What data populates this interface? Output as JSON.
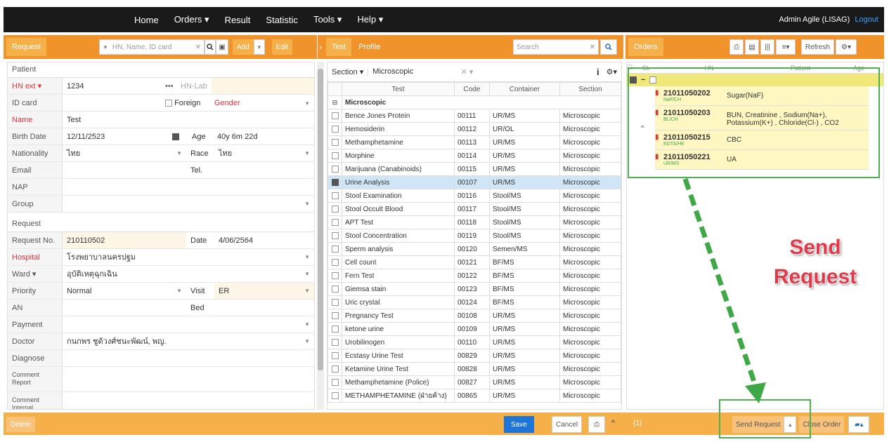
{
  "nav": {
    "items": [
      "Home",
      "Orders ▾",
      "Result",
      "Statistic",
      "Tools ▾",
      "Help ▾"
    ],
    "user": "Admin Agile (LISAG)",
    "logout": "Logout"
  },
  "request_bar": {
    "tab": "Request",
    "search_placeholder": "HN, Name, ID card",
    "add": "Add",
    "edit": "Edit"
  },
  "test_bar": {
    "tab_test": "Test",
    "tab_profile": "Profile",
    "search_placeholder": "Search"
  },
  "orders_bar": {
    "tab": "Orders",
    "refresh": "Refresh"
  },
  "patient": {
    "section": "Patient",
    "hn_label": "HN ext",
    "hn_value": "1234",
    "hnlab_label": "HN-Lab",
    "idcard_label": "ID card",
    "foreign_label": "Foreign",
    "gender_label": "Gender",
    "name_label": "Name",
    "name_value": "Test",
    "birth_label": "Birth Date",
    "birth_value": "12/11/2523",
    "age_label": "Age",
    "age_value": "40y 6m 22d",
    "nat_label": "Nationality",
    "nat_value": "ไทย",
    "race_label": "Race",
    "race_value": "ไทย",
    "email_label": "Email",
    "tel_label": "Tel.",
    "nap_label": "NAP",
    "group_label": "Group"
  },
  "request": {
    "section": "Request",
    "reqno_label": "Request No.",
    "reqno_value": "210110502",
    "date_label": "Date",
    "date_value": "4/06/2564",
    "hospital_label": "Hospital",
    "hospital_value": "โรงพยาบาลนครปฐม",
    "ward_label": "Ward",
    "ward_value": "อุบัติเหตุฉุกเฉิน",
    "priority_label": "Priority",
    "priority_value": "Normal",
    "visit_label": "Visit",
    "visit_value": "ER",
    "an_label": "AN",
    "bed_label": "Bed",
    "payment_label": "Payment",
    "doctor_label": "Doctor",
    "doctor_value": "กนกพร ชูด้วงศ์ชนะพัฒน์, พญ.",
    "diagnose_label": "Diagnose",
    "comment_report": "Comment Report",
    "comment_internal": "Comment Internal"
  },
  "tests": {
    "section_label": "Section ▾",
    "section_value": "Microscopic",
    "headers": [
      "Test",
      "Code",
      "Container",
      "Section"
    ],
    "group": "Microscopic",
    "rows": [
      {
        "name": "Bence Jones Protein",
        "code": "00111",
        "container": "UR/MS",
        "section": "Microscopic",
        "checked": false
      },
      {
        "name": "Hemosiderin",
        "code": "00112",
        "container": "UR/OL",
        "section": "Microscopic",
        "checked": false
      },
      {
        "name": "Methamphetamine",
        "code": "00113",
        "container": "UR/MS",
        "section": "Microscopic",
        "checked": false
      },
      {
        "name": "Morphine",
        "code": "00114",
        "container": "UR/MS",
        "section": "Microscopic",
        "checked": false
      },
      {
        "name": "Marijuana (Canabinoids)",
        "code": "00115",
        "container": "UR/MS",
        "section": "Microscopic",
        "checked": false
      },
      {
        "name": "Urine Analysis",
        "code": "00107",
        "container": "UR/MS",
        "section": "Microscopic",
        "checked": true
      },
      {
        "name": "Stool Examination",
        "code": "00116",
        "container": "Stool/MS",
        "section": "Microscopic",
        "checked": false
      },
      {
        "name": "Stool Occult Blood",
        "code": "00117",
        "container": "Stool/MS",
        "section": "Microscopic",
        "checked": false
      },
      {
        "name": "APT Test",
        "code": "00118",
        "container": "Stool/MS",
        "section": "Microscopic",
        "checked": false
      },
      {
        "name": "Stool Concentration",
        "code": "00119",
        "container": "Stool/MS",
        "section": "Microscopic",
        "checked": false
      },
      {
        "name": "Sperm analysis",
        "code": "00120",
        "container": "Semen/MS",
        "section": "Microscopic",
        "checked": false
      },
      {
        "name": "Cell count",
        "code": "00121",
        "container": "BF/MS",
        "section": "Microscopic",
        "checked": false
      },
      {
        "name": "Fern Test",
        "code": "00122",
        "container": "BF/MS",
        "section": "Microscopic",
        "checked": false
      },
      {
        "name": "Giemsa stain",
        "code": "00123",
        "container": "BF/MS",
        "section": "Microscopic",
        "checked": false
      },
      {
        "name": "Uric crystal",
        "code": "00124",
        "container": "BF/MS",
        "section": "Microscopic",
        "checked": false
      },
      {
        "name": "Pregnancy Test",
        "code": "00108",
        "container": "UR/MS",
        "section": "Microscopic",
        "checked": false
      },
      {
        "name": "ketone urine",
        "code": "00109",
        "container": "UR/MS",
        "section": "Microscopic",
        "checked": false
      },
      {
        "name": "Urobilinogen",
        "code": "00110",
        "container": "UR/MS",
        "section": "Microscopic",
        "checked": false
      },
      {
        "name": "Ecstasy Urine Test",
        "code": "00829",
        "container": "UR/MS",
        "section": "Microscopic",
        "checked": false
      },
      {
        "name": "Ketamine Urine Test",
        "code": "00828",
        "container": "UR/MS",
        "section": "Microscopic",
        "checked": false
      },
      {
        "name": "Methamphetamine (Police)",
        "code": "00827",
        "container": "UR/MS",
        "section": "Microscopic",
        "checked": false
      },
      {
        "name": "METHAMPHETAMINE (ฝ่ายค้าง)",
        "code": "00865",
        "container": "UR/MS",
        "section": "Microscopic",
        "checked": false
      }
    ]
  },
  "orders": {
    "headers": [
      "St.",
      "HN",
      "Patient",
      "Age"
    ],
    "items": [
      {
        "id": "21011050202",
        "tube": "NaF/CH",
        "tests": "Sugar(NaF)"
      },
      {
        "id": "21011050203",
        "tube": "BL/CH",
        "tests": "BUN, Creatinine , Sodium(Na+), Potassium(K+) , Chloride(Cl-) , CO2"
      },
      {
        "id": "21011050215",
        "tube": "EDTA/HE",
        "tests": "CBC"
      },
      {
        "id": "21011050221",
        "tube": "UR/MS",
        "tests": "UA"
      }
    ]
  },
  "bottom": {
    "delete": "Delete",
    "save": "Save",
    "cancel": "Cancel",
    "count": "(1)",
    "send": "Send Request",
    "close": "Close Order"
  },
  "annotation": {
    "line1": "Send",
    "line2": "Request"
  }
}
